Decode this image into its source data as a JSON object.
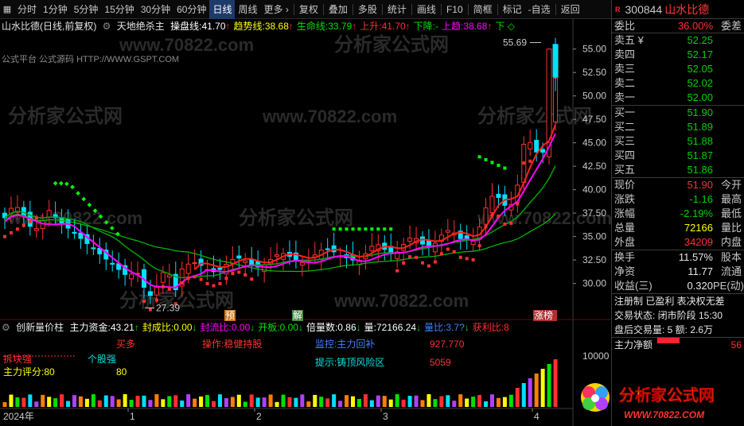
{
  "toolbar": {
    "periods": [
      "分时",
      "1分钟",
      "5分钟",
      "15分钟",
      "30分钟",
      "60分钟",
      "日线",
      "周线",
      "更多"
    ],
    "active_period": "日线",
    "more_arrow": "›",
    "tools": [
      "复权",
      "叠加",
      "多股",
      "统计",
      "画线",
      "F10",
      "简框",
      "标记",
      "-自选",
      "返回"
    ]
  },
  "legend": {
    "title": "山水比德(日线,前复权)",
    "indicator": "天地绝杀主",
    "items": [
      {
        "label": "操盘线:",
        "value": "41.70",
        "arrow": "↑",
        "color": "#ffffff"
      },
      {
        "label": "趋势线:",
        "value": "38.68",
        "arrow": "↑",
        "color": "#ffff00"
      },
      {
        "label": "生命线:",
        "value": "33.79",
        "arrow": "↑",
        "color": "#00e000"
      },
      {
        "label": "上升:",
        "value": "41.70",
        "arrow": "↑",
        "color": "#ff3030"
      },
      {
        "label": "下降:",
        "value": "-",
        "arrow": "",
        "color": "#00e000"
      },
      {
        "label": "上趋:",
        "value": "38.68",
        "arrow": "↑",
        "color": "#ff00ff"
      }
    ],
    "corner": "下 ◇",
    "watermark": "公式平台 公式源码 HTTP://WWW.GSPT.COM"
  },
  "watermarks": [
    "分析家公式网",
    "www.70822.com"
  ],
  "price_axis": [
    "55.00",
    "52.50",
    "50.00",
    "47.50",
    "45.00",
    "42.50",
    "40.00",
    "37.50",
    "35.00",
    "32.50",
    "30.00"
  ],
  "annotations": {
    "high": "55.69",
    "low": "27.39",
    "tags": [
      {
        "text": "预",
        "color": "#c87820"
      },
      {
        "text": "解",
        "color": "#4a8a40"
      },
      {
        "text": "涨榜",
        "color": "#b03030"
      }
    ]
  },
  "sub_legend": {
    "indicator": "创新量价柱",
    "items": [
      {
        "label": "主力资金:",
        "value": "43.21",
        "arrow": "↑",
        "color": "#ffffff"
      },
      {
        "label": "封成比:",
        "value": "0.00",
        "arrow": "↓",
        "color": "#ffff00"
      },
      {
        "label": "封流比:",
        "value": "0.00",
        "arrow": "↓",
        "color": "#ff00ff"
      },
      {
        "label": "开板:",
        "value": "0.00",
        "arrow": "↓",
        "color": "#00e000"
      },
      {
        "label": "倍量数:",
        "value": "0.86",
        "arrow": "↓",
        "color": "#ffffff"
      },
      {
        "label": "量:",
        "value": "72166.24",
        "arrow": "↓",
        "color": "#ffffff"
      },
      {
        "label": "量比:",
        "value": "3.7?",
        "arrow": "↓",
        "color": "#4080ff"
      },
      {
        "label": "获利比:",
        "value": "8",
        "arrow": "",
        "color": "#ff3030"
      }
    ],
    "signals": {
      "buy": "买多",
      "operation": "操作:稳健持股",
      "monitor": "监控:主力回补",
      "monitor_value": "927.770",
      "cut": "拆块强",
      "strength": "个股强",
      "tip": "提示:铸顶风险区",
      "tip_value": "5059",
      "score_label": "主力评分:80",
      "score_value": "80"
    },
    "vol_axis": "10000"
  },
  "time_axis": [
    "2024年",
    "1",
    "2",
    "3",
    "4"
  ],
  "quote": {
    "badge": "R",
    "code": "300844",
    "name": "山水比德",
    "ratio_label": "委比",
    "ratio_value": "36.00%",
    "ratio_right": "委差",
    "asks": [
      {
        "label": "卖五 ¥",
        "price": "52.25"
      },
      {
        "label": "卖四",
        "price": "52.17"
      },
      {
        "label": "卖三",
        "price": "52.05"
      },
      {
        "label": "卖二",
        "price": "52.02"
      },
      {
        "label": "卖一",
        "price": "52.00"
      }
    ],
    "bids": [
      {
        "label": "买一",
        "price": "51.90"
      },
      {
        "label": "买二",
        "price": "51.89"
      },
      {
        "label": "买三",
        "price": "51.88"
      },
      {
        "label": "买四",
        "price": "51.87"
      },
      {
        "label": "买五",
        "price": "51.86"
      }
    ],
    "stats": [
      {
        "label": "现价",
        "value": "51.90",
        "right": "今开",
        "color": "#ff3030"
      },
      {
        "label": "涨跌",
        "value": "-1.16",
        "right": "最高",
        "color": "#00d000"
      },
      {
        "label": "涨幅",
        "value": "-2.19%",
        "right": "最低",
        "color": "#00d000"
      },
      {
        "label": "总量",
        "value": "72166",
        "right": "量比",
        "color": "#ffff00"
      },
      {
        "label": "外盘",
        "value": "34209",
        "right": "内盘",
        "color": "#ff3030"
      }
    ],
    "stats2": [
      {
        "label": "换手",
        "value": "11.57%",
        "right": "股本"
      },
      {
        "label": "净资",
        "value": "11.77",
        "right": "流通"
      },
      {
        "label": "收益(三)",
        "value": "0.320",
        "right": "PE(动)"
      }
    ],
    "info1": "注册制 已盈利 表决权无差",
    "info2": "交易状态: 闭市阶段 15:30",
    "info3": "盘后交易量: 5  额: 2.6万",
    "net_label": "主力净额",
    "net_value": "56"
  },
  "logo": {
    "text": "分析家公式网",
    "url": "WWW.70822.COM"
  },
  "colors": {
    "up": "#ff3030",
    "down": "#00e0ff",
    "ma_green": "#00e000",
    "ma_magenta": "#ff00ff",
    "bg": "#000000"
  }
}
